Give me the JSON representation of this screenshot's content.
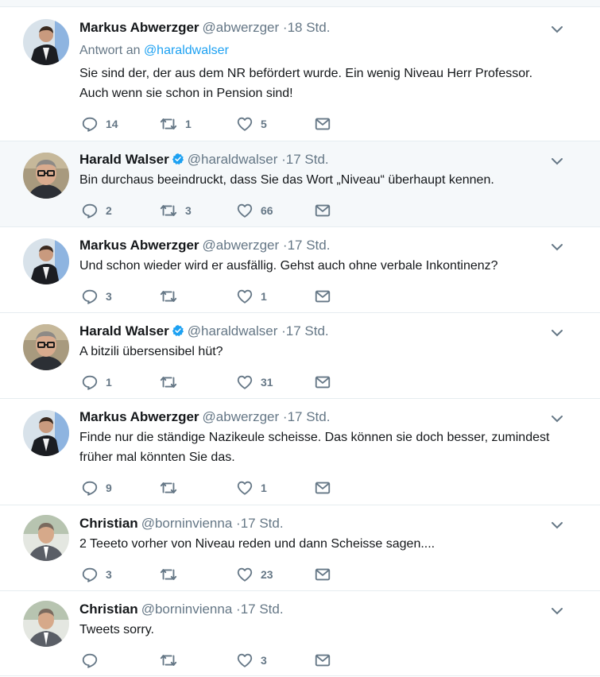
{
  "tweets": [
    {
      "author": "Markus Abwerzger",
      "handle": "@abwerzger",
      "time": "18 Std.",
      "verified": false,
      "reply_prefix": "Antwort an",
      "reply_mention": "@haraldwalser",
      "text_lines": [
        "Sie sind der, der aus dem NR befördert wurde. Ein wenig Niveau Herr Professor.",
        "Auch wenn sie schon in Pension sind!"
      ],
      "replies": "14",
      "retweets": "1",
      "likes": "5",
      "avatar": "markus"
    },
    {
      "author": "Harald Walser",
      "handle": "@haraldwalser",
      "time": "17 Std.",
      "verified": true,
      "text_lines": [
        "Bin durchaus beeindruckt, dass Sie das Wort „Niveau“ überhaupt kennen."
      ],
      "replies": "2",
      "retweets": "3",
      "likes": "66",
      "avatar": "harald"
    },
    {
      "author": "Markus Abwerzger",
      "handle": "@abwerzger",
      "time": "17 Std.",
      "verified": false,
      "text_lines": [
        "Und schon wieder wird er ausfällig. Gehst auch ohne verbale Inkontinenz?"
      ],
      "replies": "3",
      "retweets": "",
      "likes": "1",
      "avatar": "markus"
    },
    {
      "author": "Harald Walser",
      "handle": "@haraldwalser",
      "time": "17 Std.",
      "verified": true,
      "text_lines": [
        "A bitzili übersensibel hüt?"
      ],
      "replies": "1",
      "retweets": "",
      "likes": "31",
      "avatar": "harald"
    },
    {
      "author": "Markus Abwerzger",
      "handle": "@abwerzger",
      "time": "17 Std.",
      "verified": false,
      "text_lines": [
        "Finde nur die ständige Nazikeule scheisse. Das können sie doch besser, zumindest",
        "früher mal könnten Sie das."
      ],
      "replies": "9",
      "retweets": "",
      "likes": "1",
      "avatar": "markus"
    },
    {
      "author": "Christian",
      "handle": "@borninvienna",
      "time": "17 Std.",
      "verified": false,
      "text_lines": [
        "2 Teeeto vorher von Niveau reden und dann Scheisse sagen...."
      ],
      "replies": "3",
      "retweets": "",
      "likes": "23",
      "avatar": "christian"
    },
    {
      "author": "Christian",
      "handle": "@borninvienna",
      "time": "17 Std.",
      "verified": false,
      "text_lines": [
        "Tweets sorry."
      ],
      "replies": "",
      "retweets": "",
      "likes": "3",
      "avatar": "christian"
    }
  ],
  "icons": {
    "reply": "reply-icon",
    "retweet": "retweet-icon",
    "like": "heart-icon",
    "dm": "envelope-icon",
    "more": "chevron-down-icon",
    "verified": "verified-badge-icon"
  },
  "colors": {
    "text": "#14171a",
    "muted": "#657786",
    "link": "#1da1f2",
    "thread": "#a4d9f9",
    "highlight_bg": "#f5f8fa"
  }
}
